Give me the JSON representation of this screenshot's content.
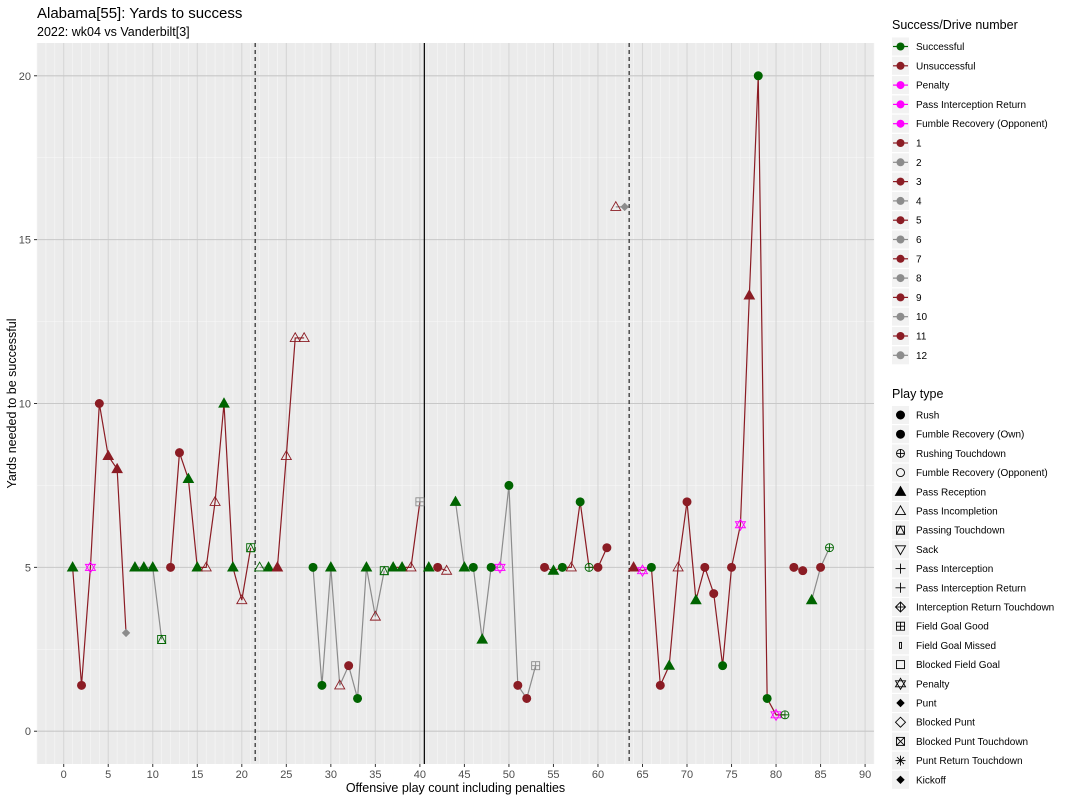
{
  "chart_data": {
    "type": "line",
    "title": "Alabama[55]: Yards to success",
    "subtitle": "2022: wk04 vs Vanderbilt[3]",
    "xlabel": "Offensive play count including penalties",
    "ylabel": "Yards needed to be successful",
    "xlim": [
      -3,
      91
    ],
    "ylim": [
      -1,
      21
    ],
    "xticks": [
      0,
      5,
      10,
      15,
      20,
      25,
      30,
      35,
      40,
      45,
      50,
      55,
      60,
      65,
      70,
      75,
      80,
      85,
      90
    ],
    "yticks": [
      0,
      5,
      10,
      15,
      20
    ],
    "xtick_labels": [
      "0",
      "5",
      "10",
      "15",
      "20",
      "25",
      "30",
      "35",
      "40",
      "45",
      "50",
      "55",
      "60",
      "65",
      "70",
      "75",
      "80",
      "85",
      "90"
    ],
    "ytick_labels": [
      "0",
      "5",
      "10",
      "15",
      "20"
    ],
    "grid": true,
    "vlines": [
      {
        "x": 21.5,
        "style": "dashed"
      },
      {
        "x": 40.5,
        "style": "solid"
      },
      {
        "x": 63.5,
        "style": "dashed"
      }
    ],
    "drives": [
      {
        "drive": 1,
        "color": "#8b1c24",
        "points": [
          [
            1,
            5,
            "pass_rec",
            "s"
          ],
          [
            2,
            1.4,
            "rush",
            "u"
          ],
          [
            3,
            5,
            "penalty",
            "p"
          ],
          [
            4,
            10,
            "rush",
            "u"
          ],
          [
            5,
            8.4,
            "pass_rec",
            "u"
          ],
          [
            6,
            8,
            "pass_rec",
            "u"
          ],
          [
            7,
            3,
            "kickoff",
            "n"
          ]
        ]
      },
      {
        "drive": 2,
        "color": "#8c8c8c",
        "points": [
          [
            8,
            5,
            "pass_rec",
            "s"
          ],
          [
            9,
            5,
            "pass_rec",
            "s"
          ],
          [
            10,
            5,
            "pass_rec",
            "s"
          ],
          [
            11,
            2.8,
            "pass_td",
            "s"
          ]
        ]
      },
      {
        "drive": 3,
        "color": "#8b1c24",
        "points": [
          [
            12,
            5,
            "rush",
            "u"
          ],
          [
            13,
            8.5,
            "rush",
            "u"
          ],
          [
            14,
            7.7,
            "pass_rec",
            "s"
          ],
          [
            15,
            5,
            "pass_rec",
            "s"
          ],
          [
            16,
            5,
            "pass_inc",
            "u"
          ],
          [
            17,
            7,
            "pass_inc",
            "u"
          ],
          [
            18,
            10,
            "pass_rec",
            "s"
          ],
          [
            19,
            5,
            "pass_rec",
            "s"
          ],
          [
            20,
            4,
            "pass_inc",
            "u"
          ],
          [
            21,
            5.6,
            "pass_td",
            "s"
          ]
        ]
      },
      {
        "drive": 4,
        "color": "#8c8c8c",
        "points": [
          [
            22,
            5,
            "pass_inc",
            "s"
          ],
          [
            23,
            5,
            "pass_rec",
            "s"
          ]
        ]
      },
      {
        "drive": 5,
        "color": "#8b1c24",
        "points": [
          [
            24,
            5,
            "pass_rec",
            "u"
          ],
          [
            25,
            8.4,
            "pass_inc",
            "u"
          ],
          [
            26,
            12,
            "pass_inc",
            "u"
          ],
          [
            27,
            12,
            "pass_inc",
            "u"
          ]
        ]
      },
      {
        "drive": 6,
        "color": "#8c8c8c",
        "points": [
          [
            28,
            5,
            "rush",
            "s"
          ],
          [
            29,
            1.4,
            "rush",
            "s"
          ],
          [
            30,
            5,
            "pass_rec",
            "s"
          ],
          [
            31,
            1.4,
            "pass_inc",
            "u"
          ],
          [
            32,
            2,
            "rush",
            "u"
          ],
          [
            33,
            1,
            "rush",
            "s"
          ],
          [
            34,
            5,
            "pass_rec",
            "s"
          ],
          [
            35,
            3.5,
            "pass_inc",
            "u"
          ],
          [
            36,
            4.9,
            "pass_td",
            "s"
          ]
        ]
      },
      {
        "drive": 7,
        "color": "#8b1c24",
        "points": [
          [
            37,
            5,
            "pass_rec",
            "s"
          ],
          [
            38,
            5,
            "pass_rec",
            "s"
          ],
          [
            39,
            5,
            "pass_inc",
            "u"
          ],
          [
            40,
            7,
            "fg_good",
            "n"
          ]
        ]
      },
      {
        "drive": 8,
        "color": "#8c8c8c",
        "points": [
          [
            41,
            5,
            "pass_rec",
            "s"
          ]
        ]
      },
      {
        "drive": 9,
        "color": "#8b1c24",
        "points": [
          [
            42,
            5,
            "rush",
            "u"
          ],
          [
            43,
            4.9,
            "pass_inc",
            "u"
          ]
        ]
      },
      {
        "drive": 10,
        "color": "#8c8c8c",
        "points": [
          [
            44,
            7,
            "pass_rec",
            "s"
          ],
          [
            45,
            5,
            "pass_rec",
            "s"
          ],
          [
            46,
            5,
            "rush",
            "s"
          ],
          [
            47,
            2.8,
            "pass_rec",
            "s"
          ],
          [
            48,
            5,
            "rush",
            "s"
          ],
          [
            49,
            5,
            "penalty",
            "p"
          ],
          [
            50,
            7.5,
            "rush",
            "s"
          ],
          [
            51,
            1.4,
            "rush",
            "u"
          ],
          [
            52,
            1,
            "rush",
            "u"
          ],
          [
            53,
            2,
            "fg_good",
            "n"
          ]
        ]
      },
      {
        "drive": 11,
        "color": "#8b1c24",
        "points": [
          [
            54,
            5,
            "rush",
            "u"
          ],
          [
            55,
            4.9,
            "pass_rec",
            "s"
          ],
          [
            56,
            5,
            "rush",
            "s"
          ],
          [
            57,
            5,
            "pass_inc",
            "u"
          ],
          [
            58,
            7,
            "rush",
            "s"
          ],
          [
            59,
            5,
            "rush_td",
            "s"
          ],
          [
            60,
            5,
            "rush",
            "u"
          ],
          [
            61,
            5.6,
            "rush",
            "u"
          ]
        ]
      },
      {
        "drive": 12,
        "color": "#8c8c8c",
        "points": [
          [
            62,
            16,
            "pass_inc",
            "u"
          ],
          [
            63,
            16,
            "kickoff",
            "n"
          ]
        ]
      },
      {
        "drive": 13,
        "color": "#8b1c24",
        "points": [
          [
            64,
            5,
            "pass_rec",
            "u"
          ],
          [
            65,
            4.9,
            "penalty",
            "p"
          ],
          [
            66,
            5,
            "rush",
            "s"
          ],
          [
            67,
            1.4,
            "rush",
            "u"
          ],
          [
            68,
            2,
            "pass_rec",
            "s"
          ],
          [
            69,
            5,
            "pass_inc",
            "u"
          ],
          [
            70,
            7,
            "rush",
            "u"
          ],
          [
            71,
            4,
            "pass_rec",
            "s"
          ],
          [
            72,
            5,
            "rush",
            "u"
          ],
          [
            73,
            4.2,
            "rush",
            "u"
          ],
          [
            74,
            2,
            "rush",
            "s"
          ],
          [
            75,
            5,
            "rush",
            "u"
          ],
          [
            76,
            6.3,
            "penalty",
            "p"
          ],
          [
            77,
            13.3,
            "pass_rec",
            "u"
          ],
          [
            78,
            20,
            "rush",
            "s"
          ],
          [
            79,
            1,
            "rush",
            "s"
          ],
          [
            80,
            0.5,
            "penalty",
            "p"
          ],
          [
            81,
            0.5,
            "rush_td",
            "s"
          ]
        ]
      },
      {
        "drive": 14,
        "color": "#8b1c24",
        "points": [
          [
            82,
            5,
            "rush",
            "u"
          ],
          [
            83,
            4.9,
            "rush",
            "u"
          ]
        ]
      },
      {
        "drive": 15,
        "color": "#8c8c8c",
        "points": [
          [
            84,
            4,
            "pass_rec",
            "s"
          ],
          [
            85,
            5,
            "rush",
            "u"
          ],
          [
            86,
            5.6,
            "rush_td",
            "s"
          ]
        ]
      }
    ],
    "point_colors": {
      "s": "#006400",
      "u": "#8b1c24",
      "p": "#ff00ff",
      "n": "#8c8c8c"
    },
    "legend_success": {
      "title": "Success/Drive number",
      "items": [
        {
          "label": "Successful",
          "color": "#006400"
        },
        {
          "label": "Unsuccessful",
          "color": "#8b1c24"
        },
        {
          "label": "Penalty",
          "color": "#ff00ff"
        },
        {
          "label": "Pass Interception Return",
          "color": "#ff00ff"
        },
        {
          "label": "Fumble Recovery (Opponent)",
          "color": "#ff00ff"
        },
        {
          "label": "1",
          "color": "#8b1c24"
        },
        {
          "label": "2",
          "color": "#8c8c8c"
        },
        {
          "label": "3",
          "color": "#8b1c24"
        },
        {
          "label": "4",
          "color": "#8c8c8c"
        },
        {
          "label": "5",
          "color": "#8b1c24"
        },
        {
          "label": "6",
          "color": "#8c8c8c"
        },
        {
          "label": "7",
          "color": "#8b1c24"
        },
        {
          "label": "8",
          "color": "#8c8c8c"
        },
        {
          "label": "9",
          "color": "#8b1c24"
        },
        {
          "label": "10",
          "color": "#8c8c8c"
        },
        {
          "label": "11",
          "color": "#8b1c24"
        },
        {
          "label": "12",
          "color": "#8c8c8c"
        }
      ]
    },
    "legend_play_type": {
      "title": "Play type",
      "items": [
        {
          "label": "Rush",
          "shape": "circle-filled"
        },
        {
          "label": "Fumble Recovery (Own)",
          "shape": "circle-filled"
        },
        {
          "label": "Rushing Touchdown",
          "shape": "circle-plus"
        },
        {
          "label": "Fumble Recovery (Opponent)",
          "shape": "circle-open"
        },
        {
          "label": "Pass Reception",
          "shape": "triangle-filled"
        },
        {
          "label": "Pass Incompletion",
          "shape": "triangle-open"
        },
        {
          "label": "Passing Touchdown",
          "shape": "square-triangle"
        },
        {
          "label": "Sack",
          "shape": "triangle-down-open"
        },
        {
          "label": "Pass Interception",
          "shape": "plus"
        },
        {
          "label": "Pass Interception Return",
          "shape": "plus"
        },
        {
          "label": "Interception Return Touchdown",
          "shape": "diamond-plus"
        },
        {
          "label": "Field Goal Good",
          "shape": "square-plus"
        },
        {
          "label": "Field Goal Missed",
          "shape": "bar"
        },
        {
          "label": "Blocked Field Goal",
          "shape": "square-open"
        },
        {
          "label": "Penalty",
          "shape": "star-of-david"
        },
        {
          "label": "Punt",
          "shape": "diamond-filled"
        },
        {
          "label": "Blocked Punt",
          "shape": "diamond-open"
        },
        {
          "label": "Blocked Punt Touchdown",
          "shape": "square-x"
        },
        {
          "label": "Punt Return Touchdown",
          "shape": "asterisk"
        },
        {
          "label": "Kickoff",
          "shape": "diamond-filled"
        }
      ]
    }
  }
}
